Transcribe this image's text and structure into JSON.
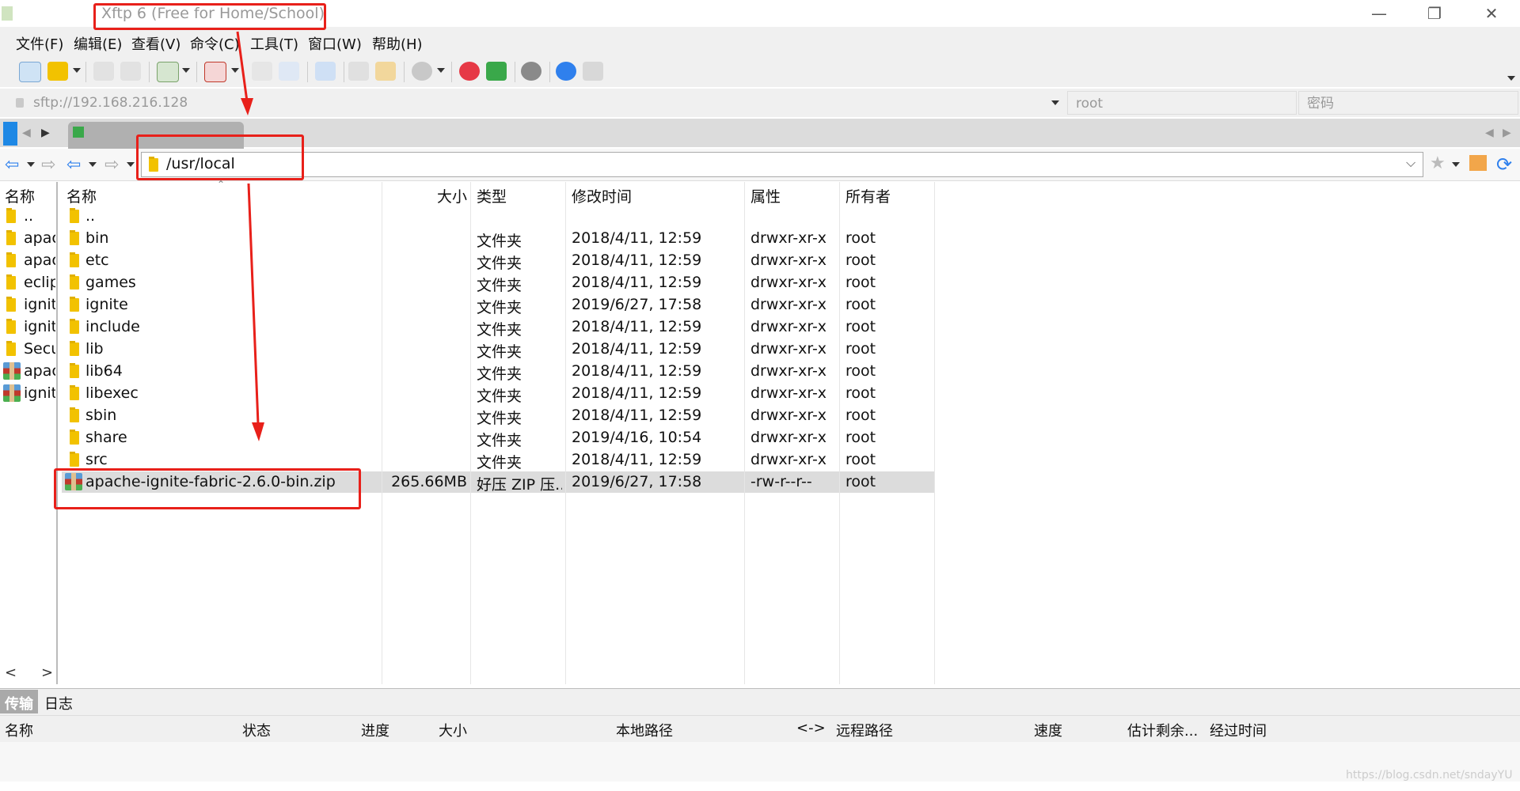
{
  "window": {
    "title": "Xftp 6 (Free for Home/School)",
    "minimize_glyph": "—",
    "restore_glyph": "❐",
    "close_glyph": "✕"
  },
  "menu": [
    "文件(F)",
    "编辑(E)",
    "查看(V)",
    "命令(C)",
    "工具(T)",
    "窗口(W)",
    "帮助(H)"
  ],
  "address": {
    "host_placeholder": "sftp://192.168.216.128",
    "user_placeholder": "root",
    "password_placeholder": "密码"
  },
  "path": "/usr/local",
  "left_pane": {
    "header": "名称",
    "items": [
      {
        "name": "..",
        "icon": "folder-icon"
      },
      {
        "name": "apac",
        "icon": "folder-icon"
      },
      {
        "name": "apac",
        "icon": "folder-icon"
      },
      {
        "name": "eclip",
        "icon": "folder-icon"
      },
      {
        "name": "ignite",
        "icon": "folder-icon"
      },
      {
        "name": "ignite",
        "icon": "folder-icon"
      },
      {
        "name": "Secur",
        "icon": "folder-icon"
      },
      {
        "name": "apac",
        "icon": "zip-archive-icon"
      },
      {
        "name": "ignite",
        "icon": "zip-archive-icon"
      }
    ]
  },
  "file_list": {
    "columns": {
      "name": "名称",
      "size": "大小",
      "type": "类型",
      "modified": "修改时间",
      "attributes": "属性",
      "owner": "所有者"
    },
    "rows": [
      {
        "name": "..",
        "size": "",
        "type": "",
        "modified": "",
        "attributes": "",
        "owner": ""
      },
      {
        "name": "bin",
        "size": "",
        "type": "文件夹",
        "modified": "2018/4/11, 12:59",
        "attributes": "drwxr-xr-x",
        "owner": "root"
      },
      {
        "name": "etc",
        "size": "",
        "type": "文件夹",
        "modified": "2018/4/11, 12:59",
        "attributes": "drwxr-xr-x",
        "owner": "root"
      },
      {
        "name": "games",
        "size": "",
        "type": "文件夹",
        "modified": "2018/4/11, 12:59",
        "attributes": "drwxr-xr-x",
        "owner": "root"
      },
      {
        "name": "ignite",
        "size": "",
        "type": "文件夹",
        "modified": "2019/6/27, 17:58",
        "attributes": "drwxr-xr-x",
        "owner": "root"
      },
      {
        "name": "include",
        "size": "",
        "type": "文件夹",
        "modified": "2018/4/11, 12:59",
        "attributes": "drwxr-xr-x",
        "owner": "root"
      },
      {
        "name": "lib",
        "size": "",
        "type": "文件夹",
        "modified": "2018/4/11, 12:59",
        "attributes": "drwxr-xr-x",
        "owner": "root"
      },
      {
        "name": "lib64",
        "size": "",
        "type": "文件夹",
        "modified": "2018/4/11, 12:59",
        "attributes": "drwxr-xr-x",
        "owner": "root"
      },
      {
        "name": "libexec",
        "size": "",
        "type": "文件夹",
        "modified": "2018/4/11, 12:59",
        "attributes": "drwxr-xr-x",
        "owner": "root"
      },
      {
        "name": "sbin",
        "size": "",
        "type": "文件夹",
        "modified": "2018/4/11, 12:59",
        "attributes": "drwxr-xr-x",
        "owner": "root"
      },
      {
        "name": "share",
        "size": "",
        "type": "文件夹",
        "modified": "2019/4/16, 10:54",
        "attributes": "drwxr-xr-x",
        "owner": "root"
      },
      {
        "name": "src",
        "size": "",
        "type": "文件夹",
        "modified": "2018/4/11, 12:59",
        "attributes": "drwxr-xr-x",
        "owner": "root"
      },
      {
        "name": "apache-ignite-fabric-2.6.0-bin.zip",
        "size": "265.66MB",
        "type": "好压 ZIP 压...",
        "modified": "2019/6/27, 17:58",
        "attributes": "-rw-r--r--",
        "owner": "root",
        "selected": true
      }
    ]
  },
  "bottom_panel": {
    "tabs": [
      "传输",
      "日志"
    ],
    "columns": [
      "名称",
      "状态",
      "进度",
      "大小",
      "本地路径",
      "<->",
      "远程路径",
      "速度",
      "估计剩余...",
      "经过时间"
    ]
  },
  "watermark": "https://blog.csdn.net/sndayYU",
  "colors": {
    "annotation_red": "#e8201a",
    "selected_row": "#dcdcdc",
    "folder_yellow": "#f2c200",
    "active_tab_blue": "#1e88e5"
  }
}
